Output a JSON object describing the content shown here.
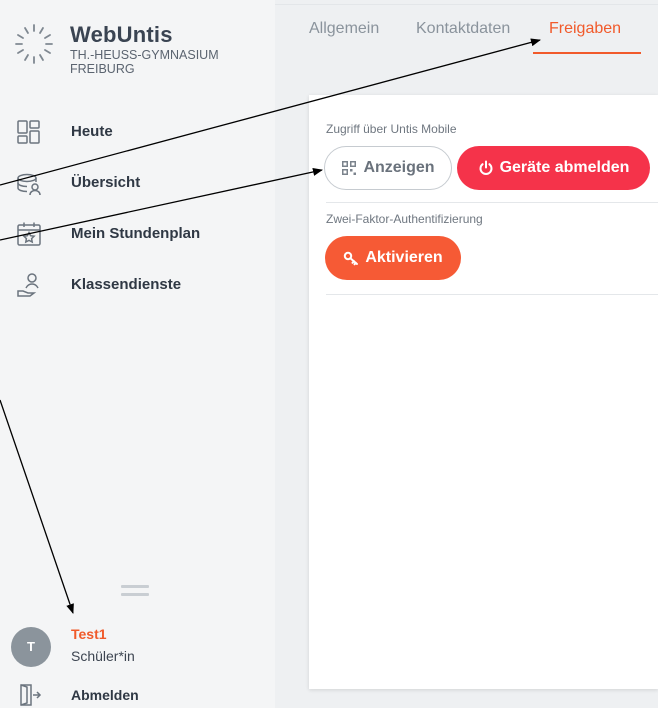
{
  "app": {
    "name": "WebUntis",
    "school": "TH.-HEUSS-GYMNASIUM FREIBURG"
  },
  "sidebar": {
    "items": [
      {
        "label": "Heute",
        "icon": "dashboard-grid-icon"
      },
      {
        "label": "Übersicht",
        "icon": "overview-stack-icon"
      },
      {
        "label": "Mein Stundenplan",
        "icon": "calendar-star-icon"
      },
      {
        "label": "Klassendienste",
        "icon": "class-duty-icon"
      }
    ],
    "user": {
      "initial": "T",
      "name": "Test1",
      "role": "Schüler*in"
    },
    "logout_label": "Abmelden"
  },
  "tabs": [
    {
      "label": "Allgemein",
      "active": false
    },
    {
      "label": "Kontaktdaten",
      "active": false
    },
    {
      "label": "Freigaben",
      "active": true
    }
  ],
  "sections": {
    "mobile": {
      "label": "Zugriff über Untis Mobile",
      "show_button": "Anzeigen",
      "logout_devices_button": "Geräte abmelden"
    },
    "twofactor": {
      "label": "Zwei-Faktor-Authentifizierung",
      "activate_button": "Aktivieren"
    }
  },
  "colors": {
    "accent": "#f15a2b",
    "danger": "#f5334a",
    "primary_button": "#f65a35",
    "sidebar_bg": "#f4f5f6",
    "main_bg": "#eef0f2"
  }
}
